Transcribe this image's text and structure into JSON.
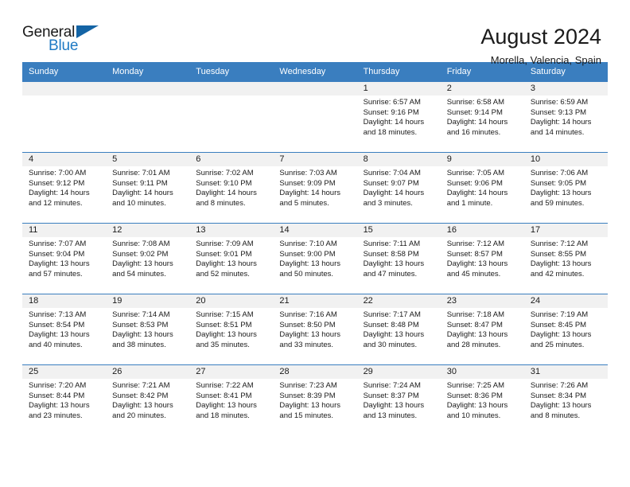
{
  "logo": {
    "word_one": "General",
    "word_two": "Blue",
    "mark": "triangle-icon"
  },
  "header": {
    "title": "August 2024",
    "subtitle": "Morella, Valencia, Spain"
  },
  "colors": {
    "header_blue": "#3a7ebf",
    "logo_blue": "#1f7ac4",
    "daynum_band": "#f1f1f1",
    "text": "#1a1a1a"
  },
  "weekday_headers": [
    "Sunday",
    "Monday",
    "Tuesday",
    "Wednesday",
    "Thursday",
    "Friday",
    "Saturday"
  ],
  "weeks": [
    [
      {
        "day": "",
        "empty": true,
        "sunrise": "",
        "sunset": "",
        "daylight_line1": "",
        "daylight_line2": ""
      },
      {
        "day": "",
        "empty": true,
        "sunrise": "",
        "sunset": "",
        "daylight_line1": "",
        "daylight_line2": ""
      },
      {
        "day": "",
        "empty": true,
        "sunrise": "",
        "sunset": "",
        "daylight_line1": "",
        "daylight_line2": ""
      },
      {
        "day": "",
        "empty": true,
        "sunrise": "",
        "sunset": "",
        "daylight_line1": "",
        "daylight_line2": ""
      },
      {
        "day": "1",
        "sunrise": "Sunrise: 6:57 AM",
        "sunset": "Sunset: 9:16 PM",
        "daylight_line1": "Daylight: 14 hours",
        "daylight_line2": "and 18 minutes."
      },
      {
        "day": "2",
        "sunrise": "Sunrise: 6:58 AM",
        "sunset": "Sunset: 9:14 PM",
        "daylight_line1": "Daylight: 14 hours",
        "daylight_line2": "and 16 minutes."
      },
      {
        "day": "3",
        "sunrise": "Sunrise: 6:59 AM",
        "sunset": "Sunset: 9:13 PM",
        "daylight_line1": "Daylight: 14 hours",
        "daylight_line2": "and 14 minutes."
      }
    ],
    [
      {
        "day": "4",
        "sunrise": "Sunrise: 7:00 AM",
        "sunset": "Sunset: 9:12 PM",
        "daylight_line1": "Daylight: 14 hours",
        "daylight_line2": "and 12 minutes."
      },
      {
        "day": "5",
        "sunrise": "Sunrise: 7:01 AM",
        "sunset": "Sunset: 9:11 PM",
        "daylight_line1": "Daylight: 14 hours",
        "daylight_line2": "and 10 minutes."
      },
      {
        "day": "6",
        "sunrise": "Sunrise: 7:02 AM",
        "sunset": "Sunset: 9:10 PM",
        "daylight_line1": "Daylight: 14 hours",
        "daylight_line2": "and 8 minutes."
      },
      {
        "day": "7",
        "sunrise": "Sunrise: 7:03 AM",
        "sunset": "Sunset: 9:09 PM",
        "daylight_line1": "Daylight: 14 hours",
        "daylight_line2": "and 5 minutes."
      },
      {
        "day": "8",
        "sunrise": "Sunrise: 7:04 AM",
        "sunset": "Sunset: 9:07 PM",
        "daylight_line1": "Daylight: 14 hours",
        "daylight_line2": "and 3 minutes."
      },
      {
        "day": "9",
        "sunrise": "Sunrise: 7:05 AM",
        "sunset": "Sunset: 9:06 PM",
        "daylight_line1": "Daylight: 14 hours",
        "daylight_line2": "and 1 minute."
      },
      {
        "day": "10",
        "sunrise": "Sunrise: 7:06 AM",
        "sunset": "Sunset: 9:05 PM",
        "daylight_line1": "Daylight: 13 hours",
        "daylight_line2": "and 59 minutes."
      }
    ],
    [
      {
        "day": "11",
        "sunrise": "Sunrise: 7:07 AM",
        "sunset": "Sunset: 9:04 PM",
        "daylight_line1": "Daylight: 13 hours",
        "daylight_line2": "and 57 minutes."
      },
      {
        "day": "12",
        "sunrise": "Sunrise: 7:08 AM",
        "sunset": "Sunset: 9:02 PM",
        "daylight_line1": "Daylight: 13 hours",
        "daylight_line2": "and 54 minutes."
      },
      {
        "day": "13",
        "sunrise": "Sunrise: 7:09 AM",
        "sunset": "Sunset: 9:01 PM",
        "daylight_line1": "Daylight: 13 hours",
        "daylight_line2": "and 52 minutes."
      },
      {
        "day": "14",
        "sunrise": "Sunrise: 7:10 AM",
        "sunset": "Sunset: 9:00 PM",
        "daylight_line1": "Daylight: 13 hours",
        "daylight_line2": "and 50 minutes."
      },
      {
        "day": "15",
        "sunrise": "Sunrise: 7:11 AM",
        "sunset": "Sunset: 8:58 PM",
        "daylight_line1": "Daylight: 13 hours",
        "daylight_line2": "and 47 minutes."
      },
      {
        "day": "16",
        "sunrise": "Sunrise: 7:12 AM",
        "sunset": "Sunset: 8:57 PM",
        "daylight_line1": "Daylight: 13 hours",
        "daylight_line2": "and 45 minutes."
      },
      {
        "day": "17",
        "sunrise": "Sunrise: 7:12 AM",
        "sunset": "Sunset: 8:55 PM",
        "daylight_line1": "Daylight: 13 hours",
        "daylight_line2": "and 42 minutes."
      }
    ],
    [
      {
        "day": "18",
        "sunrise": "Sunrise: 7:13 AM",
        "sunset": "Sunset: 8:54 PM",
        "daylight_line1": "Daylight: 13 hours",
        "daylight_line2": "and 40 minutes."
      },
      {
        "day": "19",
        "sunrise": "Sunrise: 7:14 AM",
        "sunset": "Sunset: 8:53 PM",
        "daylight_line1": "Daylight: 13 hours",
        "daylight_line2": "and 38 minutes."
      },
      {
        "day": "20",
        "sunrise": "Sunrise: 7:15 AM",
        "sunset": "Sunset: 8:51 PM",
        "daylight_line1": "Daylight: 13 hours",
        "daylight_line2": "and 35 minutes."
      },
      {
        "day": "21",
        "sunrise": "Sunrise: 7:16 AM",
        "sunset": "Sunset: 8:50 PM",
        "daylight_line1": "Daylight: 13 hours",
        "daylight_line2": "and 33 minutes."
      },
      {
        "day": "22",
        "sunrise": "Sunrise: 7:17 AM",
        "sunset": "Sunset: 8:48 PM",
        "daylight_line1": "Daylight: 13 hours",
        "daylight_line2": "and 30 minutes."
      },
      {
        "day": "23",
        "sunrise": "Sunrise: 7:18 AM",
        "sunset": "Sunset: 8:47 PM",
        "daylight_line1": "Daylight: 13 hours",
        "daylight_line2": "and 28 minutes."
      },
      {
        "day": "24",
        "sunrise": "Sunrise: 7:19 AM",
        "sunset": "Sunset: 8:45 PM",
        "daylight_line1": "Daylight: 13 hours",
        "daylight_line2": "and 25 minutes."
      }
    ],
    [
      {
        "day": "25",
        "sunrise": "Sunrise: 7:20 AM",
        "sunset": "Sunset: 8:44 PM",
        "daylight_line1": "Daylight: 13 hours",
        "daylight_line2": "and 23 minutes."
      },
      {
        "day": "26",
        "sunrise": "Sunrise: 7:21 AM",
        "sunset": "Sunset: 8:42 PM",
        "daylight_line1": "Daylight: 13 hours",
        "daylight_line2": "and 20 minutes."
      },
      {
        "day": "27",
        "sunrise": "Sunrise: 7:22 AM",
        "sunset": "Sunset: 8:41 PM",
        "daylight_line1": "Daylight: 13 hours",
        "daylight_line2": "and 18 minutes."
      },
      {
        "day": "28",
        "sunrise": "Sunrise: 7:23 AM",
        "sunset": "Sunset: 8:39 PM",
        "daylight_line1": "Daylight: 13 hours",
        "daylight_line2": "and 15 minutes."
      },
      {
        "day": "29",
        "sunrise": "Sunrise: 7:24 AM",
        "sunset": "Sunset: 8:37 PM",
        "daylight_line1": "Daylight: 13 hours",
        "daylight_line2": "and 13 minutes."
      },
      {
        "day": "30",
        "sunrise": "Sunrise: 7:25 AM",
        "sunset": "Sunset: 8:36 PM",
        "daylight_line1": "Daylight: 13 hours",
        "daylight_line2": "and 10 minutes."
      },
      {
        "day": "31",
        "sunrise": "Sunrise: 7:26 AM",
        "sunset": "Sunset: 8:34 PM",
        "daylight_line1": "Daylight: 13 hours",
        "daylight_line2": "and 8 minutes."
      }
    ]
  ]
}
